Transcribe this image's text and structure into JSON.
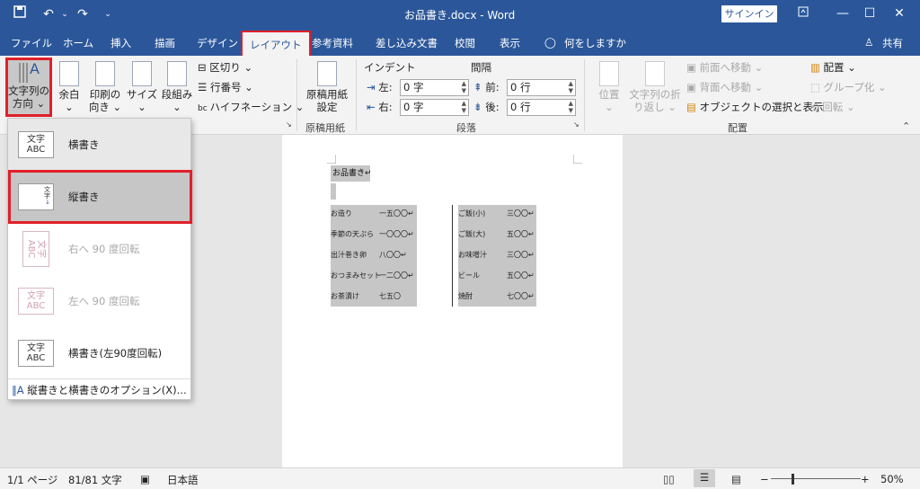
{
  "window": {
    "title": "お品書き.docx  -  Word",
    "signin_label": "サインイン"
  },
  "tabs": [
    {
      "label": "ファイル"
    },
    {
      "label": "ホーム"
    },
    {
      "label": "挿入"
    },
    {
      "label": "描画"
    },
    {
      "label": "デザイン"
    },
    {
      "label": "レイアウト"
    },
    {
      "label": "参考資料"
    },
    {
      "label": "差し込み文書"
    },
    {
      "label": "校閲"
    },
    {
      "label": "表示"
    },
    {
      "label": "何をしますか"
    }
  ],
  "share_label": "共有",
  "ribbon": {
    "text_direction_label": "文字列の\n方向",
    "text_direction_l1": "文字列の",
    "text_direction_l2": "方向",
    "margins_label": "余白",
    "orientation_l1": "印刷の",
    "orientation_l2": "向き",
    "size_label": "サイズ",
    "columns_label": "段組み",
    "breaks_label": "区切り",
    "line_numbers_label": "行番号",
    "hyphenation_label": "ハイフネーション",
    "genko_l1": "原稿用紙",
    "genko_l2": "設定",
    "genko_group": "原稿用紙",
    "indent_label": "インデント",
    "spacing_label": "間隔",
    "indent_left_label": "左:",
    "indent_left_value": "0 字",
    "indent_right_label": "右:",
    "indent_right_value": "0 字",
    "spacing_before_label": "前:",
    "spacing_before_value": "0 行",
    "spacing_after_label": "後:",
    "spacing_after_value": "0 行",
    "paragraph_group": "段落",
    "position_label": "位置",
    "wrap_l1": "文字列の折",
    "wrap_l2": "り返し",
    "bring_forward_label": "前面へ移動",
    "send_backward_label": "背面へ移動",
    "selection_pane_label": "オブジェクトの選択と表示",
    "align_label": "配置",
    "group_label": "グループ化",
    "rotate_label": "回転",
    "arrange_group": "配置"
  },
  "menu": {
    "items": [
      {
        "label": "横書き",
        "icon_text": "文字 ABC"
      },
      {
        "label": "縦書き",
        "icon_text": "文字ABC"
      },
      {
        "label": "右へ 90 度回転",
        "icon_text": "文字ABC"
      },
      {
        "label": "左へ 90 度回転",
        "icon_text": "文字 ABC"
      },
      {
        "label": "横書き(左90度回転)",
        "icon_text": "文字 ABC"
      }
    ],
    "options_label": "縦書きと横書きのオプション(X)..."
  },
  "document": {
    "title": "お品書き↵",
    "left_items": [
      {
        "name": "お造り",
        "price": "一五〇〇↵"
      },
      {
        "name": "季節の天ぷら",
        "price": "一〇〇〇↵"
      },
      {
        "name": "出汁巻き卵",
        "price": "八〇〇↵"
      },
      {
        "name": "おつまみセット",
        "price": "一二〇〇↵"
      },
      {
        "name": "お茶漬け",
        "price": "七五〇"
      }
    ],
    "right_items": [
      {
        "name": "ご飯(小)",
        "price": "三〇〇↵"
      },
      {
        "name": "ご飯(大)",
        "price": "五〇〇↵"
      },
      {
        "name": "お味噌汁",
        "price": "三〇〇↵"
      },
      {
        "name": "ビール",
        "price": "五〇〇↵"
      },
      {
        "name": "焼酎",
        "price": "七〇〇↵"
      }
    ]
  },
  "status": {
    "page": "1/1 ページ",
    "words": "81/81 文字",
    "language": "日本語",
    "zoom": "50%"
  },
  "colors": {
    "accent": "#2b579a",
    "highlight": "#e0202a"
  }
}
